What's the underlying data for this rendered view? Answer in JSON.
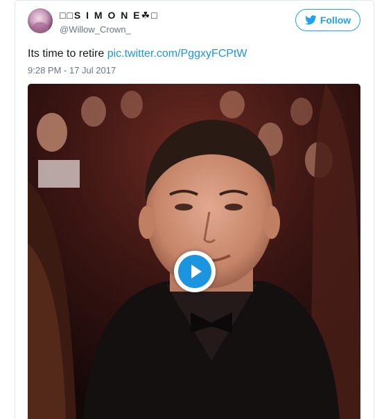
{
  "tweet": {
    "display_name": "□□S I M O N E☘□",
    "handle": "@Willow_Crown_",
    "follow_label": "Follow",
    "text": "Its time to retire ",
    "link_text": "pic.twitter.com/PggxyFCPtW",
    "timestamp": "9:28 PM - 17 Jul 2017"
  },
  "icons": {
    "bird": "twitter-bird-icon",
    "play": "play-icon"
  },
  "colors": {
    "accent": "#1da1f2",
    "link": "#1b95e0",
    "secondary_text": "#657786",
    "border": "#e1e8ed"
  }
}
